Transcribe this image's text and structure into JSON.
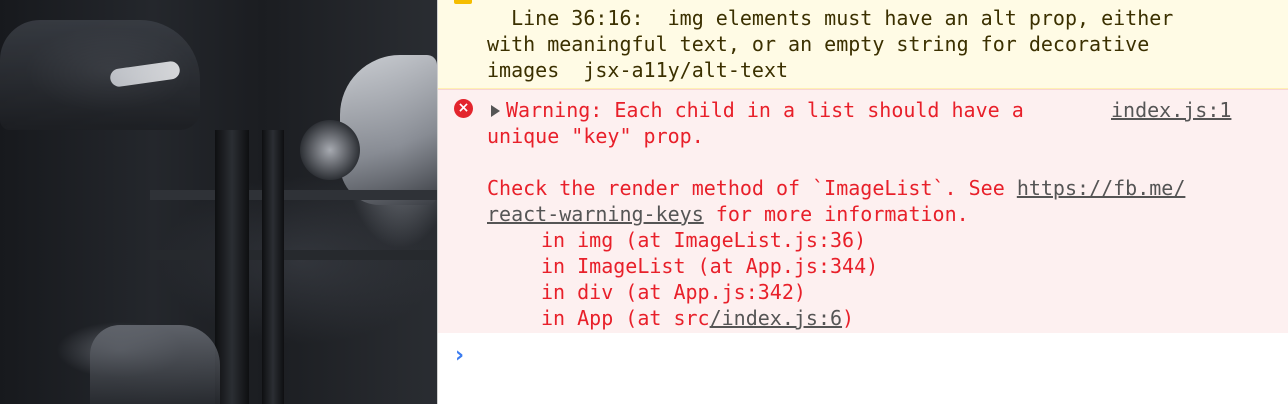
{
  "warning": {
    "line1": "  Line 36:16:  img elements must have an alt prop, either",
    "line2": "with meaningful text, or an empty string for decorative",
    "line3": "images  jsx-a11y/alt-text"
  },
  "error": {
    "icon": "error-circle-icon",
    "headline_1": "Warning: Each child in a list should have a",
    "headline_2": "unique \"key\" prop.",
    "source_link": "index.js:1",
    "check_prefix": "Check the render method of `ImageList`. See ",
    "docs_link_1": "https://fb.me/",
    "docs_link_2": "react-warning-keys",
    "docs_suffix": " for more information.",
    "stack": {
      "img": "in img (at ImageList.js:36)",
      "imagelist": "in ImageList (at App.js:344)",
      "div": "in div (at App.js:342)",
      "app_prefix": "in App (at src",
      "app_link": "/index.js:6",
      "app_suffix": ")"
    },
    "color": "#e8202a"
  },
  "prompt": {
    "icon": "chevron-right-icon",
    "value": "",
    "accent": "#3b7cf0"
  }
}
